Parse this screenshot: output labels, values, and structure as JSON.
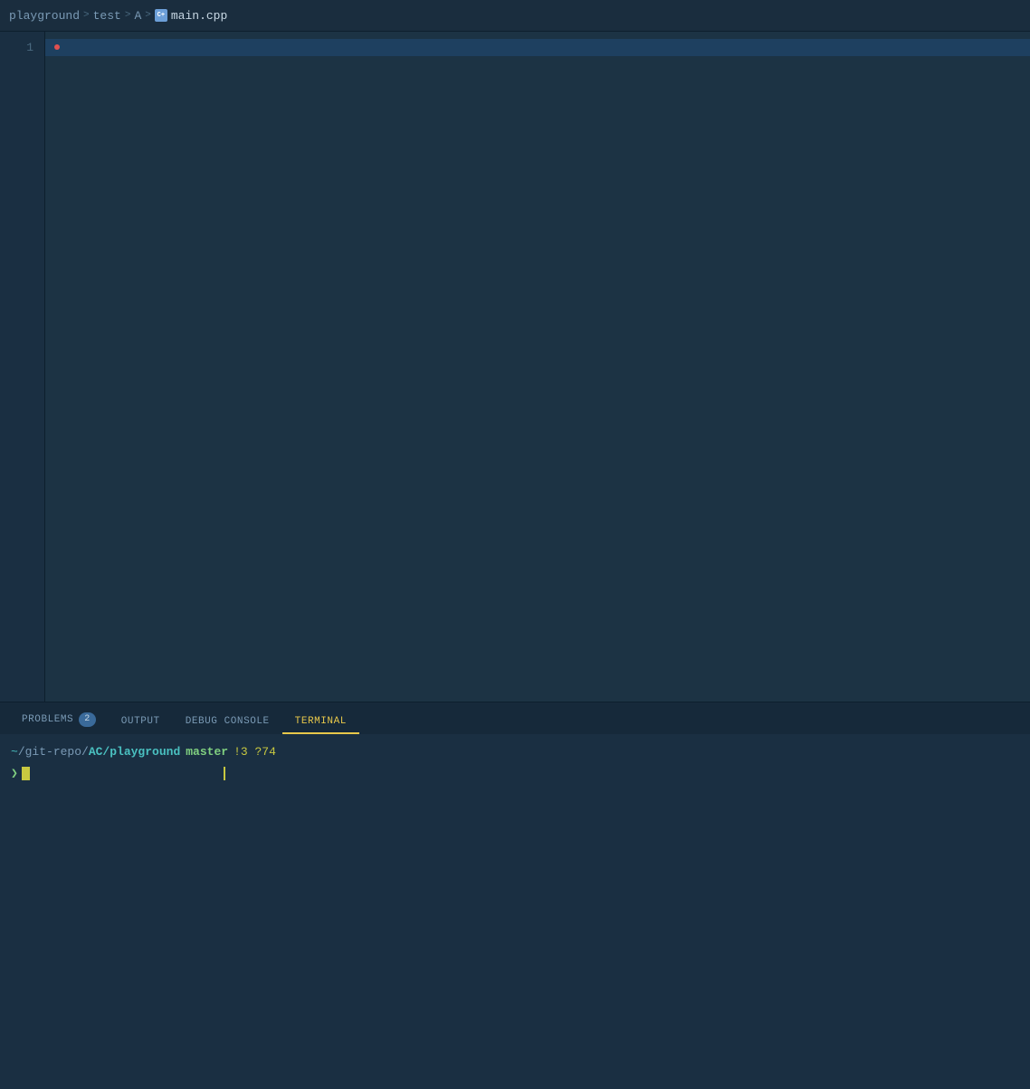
{
  "breadcrumb": {
    "items": [
      {
        "label": "playground",
        "type": "folder"
      },
      {
        "label": "test",
        "type": "folder"
      },
      {
        "label": "A",
        "type": "folder"
      },
      {
        "label": "main.cpp",
        "type": "file"
      }
    ],
    "separators": [
      ">",
      ">",
      ">"
    ]
  },
  "editor": {
    "line_number": "1",
    "background_color": "#1c3344"
  },
  "panel": {
    "tabs": [
      {
        "label": "PROBLEMS",
        "badge": "2",
        "active": false
      },
      {
        "label": "OUTPUT",
        "badge": null,
        "active": false
      },
      {
        "label": "DEBUG CONSOLE",
        "badge": null,
        "active": false
      },
      {
        "label": "TERMINAL",
        "badge": null,
        "active": true
      }
    ]
  },
  "terminal": {
    "prompt": {
      "tilde": "~",
      "path_prefix": "/git-repo/",
      "path_bold": "AC/playground",
      "branch": "master",
      "status": "!3 ?74"
    },
    "cursor_chevron": "❯"
  }
}
